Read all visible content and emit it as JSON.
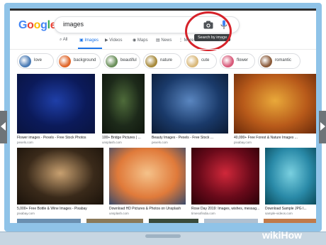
{
  "google": {
    "logo_letters": [
      {
        "char": "G",
        "color": "#4285F4"
      },
      {
        "char": "o",
        "color": "#EA4335"
      },
      {
        "char": "o",
        "color": "#FBBC05"
      },
      {
        "char": "g",
        "color": "#4285F4"
      },
      {
        "char": "l",
        "color": "#34A853"
      },
      {
        "char": "e",
        "color": "#EA4335"
      }
    ]
  },
  "search": {
    "query": "images",
    "camera_icon": "camera-icon",
    "mic_icon": "microphone-icon",
    "tooltip": "Search by image"
  },
  "nav": {
    "items": [
      {
        "label": "All",
        "icon": "search-icon",
        "active": false
      },
      {
        "label": "Images",
        "icon": "image-icon",
        "active": true
      },
      {
        "label": "Videos",
        "icon": "video-icon",
        "active": false
      },
      {
        "label": "Maps",
        "icon": "map-icon",
        "active": false
      },
      {
        "label": "News",
        "icon": "news-icon",
        "active": false
      },
      {
        "label": "More",
        "icon": "more-icon",
        "active": false
      },
      {
        "label": "ols",
        "icon": "",
        "active": false
      }
    ],
    "accent_color": "#1a73e8"
  },
  "chips": [
    {
      "label": "love",
      "color": "#4a7bb5"
    },
    {
      "label": "background",
      "color": "#e0662a"
    },
    {
      "label": "beautiful",
      "color": "#6a8f5a"
    },
    {
      "label": "nature",
      "color": "#a78a3c"
    },
    {
      "label": "cute",
      "color": "#d9b87a"
    },
    {
      "label": "flower",
      "color": "#d85a7a"
    },
    {
      "label": "romantic",
      "color": "#8a5a3a"
    }
  ],
  "results": [
    {
      "title": "Flower images - Pexels - Free Stock Photos",
      "source": "pexels.com",
      "colors": [
        "#0b1a5a",
        "#1f3fa8",
        "#0a1440"
      ]
    },
    {
      "title": "100+ Bridge Pictures | ...",
      "source": "unsplash.com",
      "colors": [
        "#1d2a1a",
        "#4e6b3a",
        "#0f160d"
      ]
    },
    {
      "title": "Beauty Images - Pexels - Free Stock ...",
      "source": "pexels.com",
      "colors": [
        "#1a3a6a",
        "#5a86c0",
        "#0b1a33"
      ]
    },
    {
      "title": "40,000+ Free Forest & Nature Images ...",
      "source": "pixabay.com",
      "colors": [
        "#b85a1a",
        "#e9a93a",
        "#6a2a0a"
      ]
    },
    {
      "title": "5,000+ Free Bottle & Wine Images - Pixabay",
      "source": "pixabay.com",
      "colors": [
        "#3a2a1a",
        "#c8a070",
        "#1a120a"
      ]
    },
    {
      "title": "Download HD Pictures & Photos on Unsplash",
      "source": "unsplash.com",
      "colors": [
        "#e07a3a",
        "#f5c28a",
        "#3a4a6a"
      ]
    },
    {
      "title": "Rose Day 2019: Images, wishes, messag...",
      "source": "timesofindia.com",
      "colors": [
        "#6a0a1a",
        "#d0283a",
        "#2a0008"
      ]
    },
    {
      "title": "Download Sample JPG I...",
      "source": "sample-videos.com",
      "colors": [
        "#2a8aa8",
        "#7ad0e0",
        "#0a4a5a"
      ]
    }
  ],
  "watermark": {
    "wiki": "wiki",
    "how": "How"
  }
}
